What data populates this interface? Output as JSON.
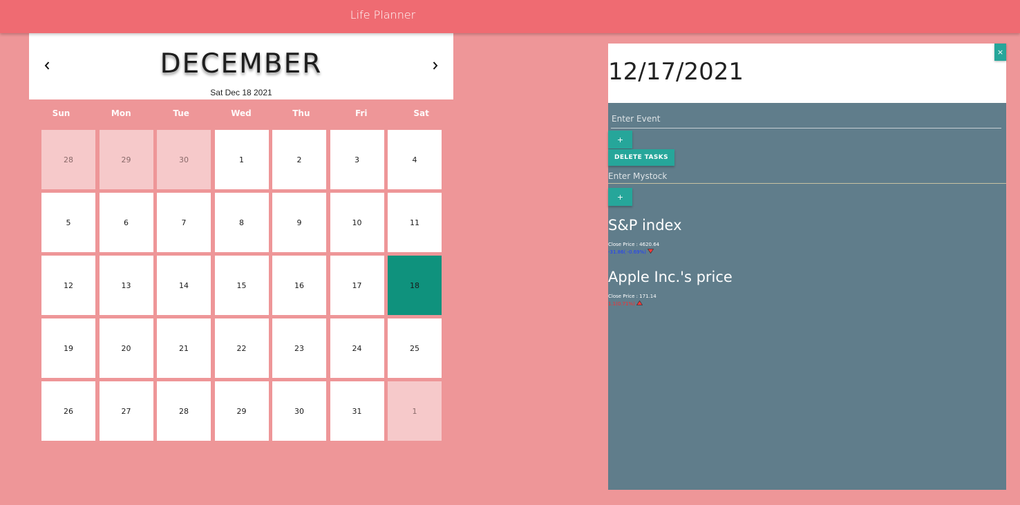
{
  "app": {
    "title": "Life Planner"
  },
  "calendar": {
    "month": "DECEMBER",
    "current_date": "Sat Dec 18 2021",
    "prev_icon": "chevron-left-icon",
    "next_icon": "chevron-right-icon",
    "weekdays": [
      "Sun",
      "Mon",
      "Tue",
      "Wed",
      "Thu",
      "Fri",
      "Sat"
    ],
    "days": [
      {
        "label": "28",
        "other": true
      },
      {
        "label": "29",
        "other": true
      },
      {
        "label": "30",
        "other": true
      },
      {
        "label": "1"
      },
      {
        "label": "2"
      },
      {
        "label": "3"
      },
      {
        "label": "4"
      },
      {
        "label": "5"
      },
      {
        "label": "6"
      },
      {
        "label": "7"
      },
      {
        "label": "8"
      },
      {
        "label": "9"
      },
      {
        "label": "10"
      },
      {
        "label": "11"
      },
      {
        "label": "12"
      },
      {
        "label": "13"
      },
      {
        "label": "14"
      },
      {
        "label": "15"
      },
      {
        "label": "16"
      },
      {
        "label": "17"
      },
      {
        "label": "18",
        "selected": true
      },
      {
        "label": "19"
      },
      {
        "label": "20"
      },
      {
        "label": "21"
      },
      {
        "label": "22"
      },
      {
        "label": "23"
      },
      {
        "label": "24"
      },
      {
        "label": "25"
      },
      {
        "label": "26"
      },
      {
        "label": "27"
      },
      {
        "label": "28"
      },
      {
        "label": "29"
      },
      {
        "label": "30"
      },
      {
        "label": "31"
      },
      {
        "label": "1",
        "other": true
      }
    ],
    "selected_color": "#0f927d"
  },
  "panel": {
    "date": "12/17/2021",
    "close_label": "×",
    "event_placeholder": "Enter Event",
    "add_event_label": "+",
    "delete_tasks_label": "DELETE TASKS",
    "stock_placeholder": "Enter Mystock",
    "add_stock_label": "+"
  },
  "stocks": [
    {
      "title": "S&P index",
      "close": "Close Price : 4620.64",
      "change": "-31.86( -0.69%)",
      "direction": "down",
      "color": "#1e3cff"
    },
    {
      "title": "Apple Inc.'s price",
      "close": "Close Price : 171.14",
      "change": "1.1(0.71%)",
      "direction": "up",
      "color": "#ff2a2a"
    }
  ],
  "colors": {
    "header": "#ef6b72",
    "background": "#ee9698",
    "panel": "#607d8b",
    "button": "#26a69a"
  }
}
